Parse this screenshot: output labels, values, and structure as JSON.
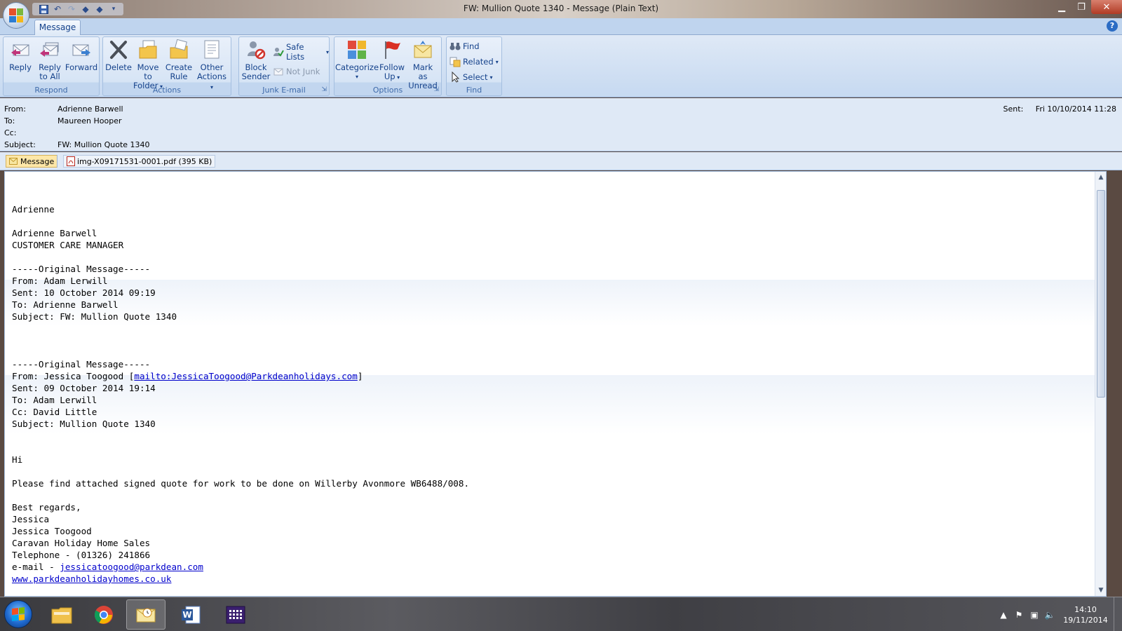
{
  "window": {
    "title": "FW: Mullion Quote 1340 - Message (Plain Text)"
  },
  "tabs": {
    "message": "Message"
  },
  "ribbon": {
    "respond": {
      "label": "Respond",
      "reply": "Reply",
      "reply_all": [
        "Reply",
        "to All"
      ],
      "forward": "Forward"
    },
    "actions": {
      "label": "Actions",
      "delete": "Delete",
      "move_to_folder": [
        "Move to",
        "Folder"
      ],
      "create_rule": [
        "Create",
        "Rule"
      ],
      "other_actions": [
        "Other",
        "Actions"
      ]
    },
    "junk": {
      "label": "Junk E-mail",
      "block_sender": [
        "Block",
        "Sender"
      ],
      "safe_lists": "Safe Lists",
      "not_junk": "Not Junk"
    },
    "options": {
      "label": "Options",
      "categorize": "Categorize",
      "follow_up": [
        "Follow",
        "Up"
      ],
      "mark_unread": [
        "Mark as",
        "Unread"
      ]
    },
    "find": {
      "label": "Find",
      "find": "Find",
      "related": "Related",
      "select": "Select"
    }
  },
  "header": {
    "from_label": "From:",
    "from": "Adrienne Barwell",
    "to_label": "To:",
    "to": "Maureen Hooper",
    "cc_label": "Cc:",
    "cc": "",
    "subject_label": "Subject:",
    "subject": "FW: Mullion Quote 1340",
    "sent_label": "Sent:",
    "sent": "Fri 10/10/2014 11:28"
  },
  "attachments": {
    "message_tab": "Message",
    "file": "img-X09171531-0001.pdf (395 KB)"
  },
  "body": {
    "line1": "Adrienne",
    "line2": "Adrienne Barwell",
    "line3": "CUSTOMER CARE MANAGER",
    "orig1_sep": "-----Original Message-----",
    "orig1_from": "From: Adam Lerwill",
    "orig1_sent": "Sent: 10 October 2014 09:19",
    "orig1_to": "To: Adrienne Barwell",
    "orig1_subject": "Subject: FW: Mullion Quote 1340",
    "orig2_sep": "-----Original Message-----",
    "orig2_from_prefix": "From: Jessica Toogood [",
    "orig2_from_link": "mailto:JessicaToogood@Parkdeanholidays.com",
    "orig2_from_suffix": "]",
    "orig2_sent": "Sent: 09 October 2014 19:14",
    "orig2_to": "To: Adam Lerwill",
    "orig2_cc": "Cc: David Little",
    "orig2_subject": "Subject: Mullion Quote 1340",
    "hi": "Hi",
    "para": "Please find attached signed quote for work to be done on Willerby Avonmore WB6488/008.",
    "regards": "Best regards,",
    "sig1": "Jessica",
    "sig2": "Jessica Toogood",
    "sig3": "Caravan Holiday Home Sales",
    "sig4": "Telephone - (01326) 241866",
    "email_prefix": "e-mail - ",
    "email_link": "jessicatoogood@parkdean.com",
    "web_link": "www.parkdeanholidayhomes.co.uk"
  },
  "taskbar": {
    "time": "14:10",
    "date": "19/11/2014",
    "apps": [
      "explorer-icon",
      "chrome-icon",
      "outlook-icon",
      "word-icon",
      "calendar-app-icon"
    ]
  },
  "colors": {
    "ribbon_text": "#15428b",
    "link": "#0000cc",
    "group_label": "#3e6aaa"
  }
}
